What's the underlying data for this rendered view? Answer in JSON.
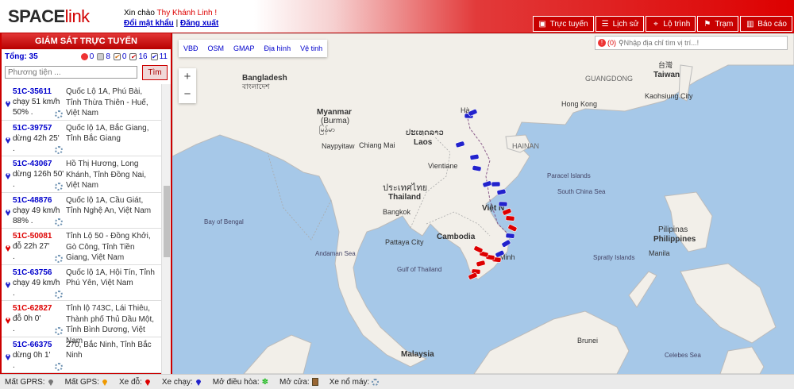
{
  "app": {
    "logo_part1": "SPACE",
    "logo_part2": "link"
  },
  "header": {
    "greeting": "Xin chào",
    "user_name": "Thy Khánh Linh !",
    "change_password": "Đổi mật khẩu",
    "separator": "|",
    "logout": "Đăng xuất",
    "nav": [
      {
        "label": "Trực tuyến",
        "icon": "monitor-icon"
      },
      {
        "label": "Lịch sử",
        "icon": "history-icon"
      },
      {
        "label": "Lộ trình",
        "icon": "route-icon"
      },
      {
        "label": "Trạm",
        "icon": "station-icon"
      },
      {
        "label": "Báo cáo",
        "icon": "report-icon"
      }
    ]
  },
  "panel": {
    "title": "GIÁM SÁT TRỰC TUYẾN",
    "total_label": "Tổng: 35",
    "counts": {
      "alert": "0",
      "stopped": "8",
      "checked1": "0",
      "checked2": "16",
      "checked3": "11"
    },
    "search_placeholder": "Phương tiện ...",
    "search_button": "Tìm",
    "vehicles": [
      {
        "plate": "51C-35611",
        "status": "chạy 51 km/h",
        "extra": "50% .",
        "address": "Quốc Lộ 1A, Phú Bài, Tỉnh Thừa Thiên - Huế, Việt Nam",
        "state": "running"
      },
      {
        "plate": "51C-39757",
        "status": "dừng 42h 25'",
        "extra": ".",
        "address": "Quốc lộ 1A, Bắc Giang, Tỉnh Bắc Giang",
        "state": "running"
      },
      {
        "plate": "51C-43067",
        "status": "dừng 126h 50'",
        "extra": ".",
        "address": "Hồ Thị Hương, Long Khánh, Tỉnh Đồng Nai, Việt Nam",
        "state": "running"
      },
      {
        "plate": "51C-48876",
        "status": "chạy 49 km/h",
        "extra": "88% .",
        "address": "Quốc lộ 1A, Cầu Giát, Tỉnh Nghệ An, Việt Nam",
        "state": "running"
      },
      {
        "plate": "51C-50081",
        "status": "đỗ 22h 27'",
        "extra": ".",
        "address": "Tỉnh Lộ 50 - Đồng Khởi, Gò Công, Tỉnh Tiền Giang, Việt Nam",
        "state": "parked"
      },
      {
        "plate": "51C-63756",
        "status": "chạy 49 km/h",
        "extra": ".",
        "address": "Quốc lộ 1A, Hội Tín, Tỉnh Phú Yên, Việt Nam",
        "state": "running"
      },
      {
        "plate": "51C-62827",
        "status": "đỗ 0h 0'",
        "extra": ".",
        "address": "Tỉnh lộ 743C, Lái Thiêu, Thành phố Thủ Dầu Một, Tỉnh Bình Dương, Việt Nam",
        "state": "parked"
      },
      {
        "plate": "51C-66375",
        "status": "dừng 0h 1'",
        "extra": ".",
        "address": "270, Bắc Ninh, Tỉnh Bắc Ninh",
        "state": "running"
      }
    ]
  },
  "map": {
    "layers": [
      "VBĐ",
      "OSM",
      "GMAP",
      "Địa hình",
      "Vệ tinh"
    ],
    "zoom_in": "+",
    "zoom_out": "−",
    "alert_count": "(0)",
    "address_placeholder": "Nhập địa chỉ tìm vị trí...!",
    "labels": {
      "bangladesh": "Bangladesh",
      "bangladesh_native": "বাংলাদেশ",
      "myanmar": "Myanmar",
      "burma": "(Burma)",
      "myanmar_native": "မြန်မာ",
      "naypyitaw": "Naypyitaw",
      "chiangmai": "Chiang Mai",
      "laos": "Laos",
      "laos_native": "ປະເທດລາວ",
      "vientiane": "Vientiane",
      "thailand_native": "ประเทศไทย",
      "thailand": "Thailand",
      "bangkok": "Bangkok",
      "cambodia": "Cambodia",
      "pattaya": "Pattaya City",
      "vietnam": "Việt N",
      "hainan": "HAINAN",
      "guangdong": "GUANGDONG",
      "hongkong": "Hong Kong",
      "taiwan": "Taiwan",
      "taiwan_native": "台灣",
      "kaohsiung": "Kaohsiung City",
      "philippines": "Philippines",
      "philippines_native": "Pilipinas",
      "manila": "Manila",
      "paracel": "Paracel Islands",
      "south_china_sea": "South China Sea",
      "bay_of_bengal": "Bay of Bengal",
      "andaman": "Andaman Sea",
      "gulf_thailand": "Gulf of Thailand",
      "celebes": "Celebes Sea",
      "malaysia": "Malaysia",
      "malaysia_native": "Malaysia",
      "brunei": "Brunei",
      "minh": "Minh",
      "hanoi": "Hà",
      "spratly": "Spratly Islands"
    }
  },
  "footer": [
    {
      "label": "Mất GPRS:",
      "icon": "gprs-lost-pin-icon"
    },
    {
      "label": "Mất GPS:",
      "icon": "gps-lost-pin-icon"
    },
    {
      "label": "Xe đỗ:",
      "icon": "parked-pin-icon"
    },
    {
      "label": "Xe chạy:",
      "icon": "running-pin-icon"
    },
    {
      "label": "Mở điều hòa:",
      "icon": "aircon-icon"
    },
    {
      "label": "Mở cửa:",
      "icon": "door-icon"
    },
    {
      "label": "Xe nổ máy:",
      "icon": "engine-gear-icon"
    }
  ],
  "colors": {
    "brand_red": "#cc0000",
    "running_blue": "#2222cc",
    "parked_red": "#dd0000",
    "sea": "#a6c8e8",
    "land": "#f2efe9"
  }
}
